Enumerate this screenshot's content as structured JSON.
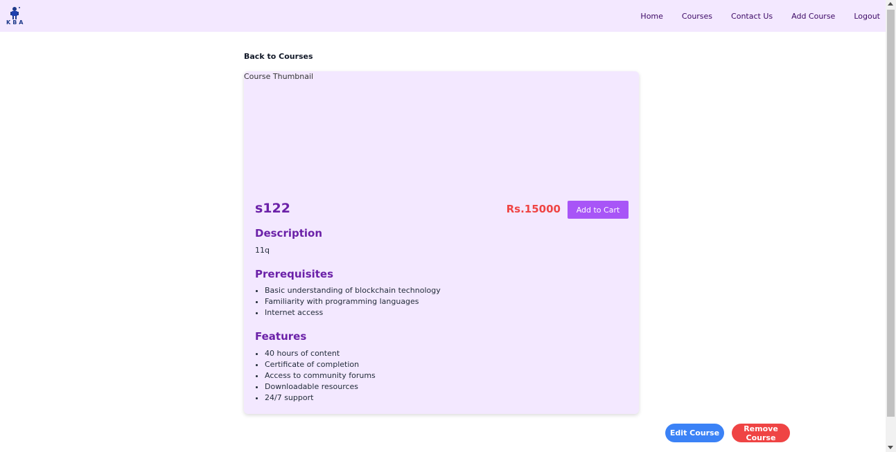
{
  "brand": {
    "logo_text": "KBA"
  },
  "nav": {
    "items": [
      {
        "label": "Home"
      },
      {
        "label": "Courses"
      },
      {
        "label": "Contact Us"
      },
      {
        "label": "Add Course"
      },
      {
        "label": "Logout"
      }
    ]
  },
  "page": {
    "back_link": "Back to Courses",
    "thumbnail_alt": "Course Thumbnail",
    "course_title": "s122",
    "price": "Rs.15000",
    "add_to_cart": "Add to Cart",
    "description_heading": "Description",
    "description_text": "11q",
    "prerequisites_heading": "Prerequisites",
    "prerequisites": [
      "Basic understanding of blockchain technology",
      "Familiarity with programming languages",
      "Internet access"
    ],
    "features_heading": "Features",
    "features": [
      "40 hours of content",
      "Certificate of completion",
      "Access to community forums",
      "Downloadable resources",
      "24/7 support"
    ]
  },
  "actions": {
    "edit_course": "Edit Course",
    "remove_course": "Remove Course"
  },
  "colors": {
    "nav_bg": "#f3e8ff",
    "card_bg": "#f3e8ff",
    "heading": "#6b21a8",
    "price": "#ef4444",
    "add_cart_bg": "#a855f7",
    "edit_bg": "#3b82f6",
    "remove_bg": "#ef4444"
  }
}
